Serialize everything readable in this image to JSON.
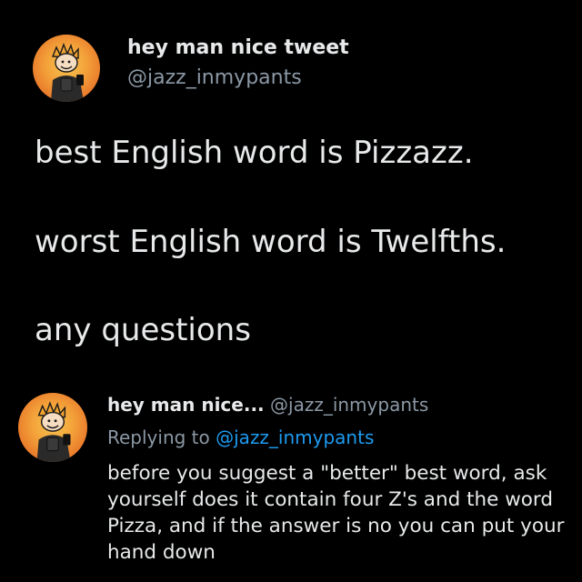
{
  "main_tweet": {
    "author_name": "hey man nice tweet",
    "author_handle": "@jazz_inmypants",
    "avatar_icon": "cartoon-boy-avatar-icon",
    "lines": [
      "best English word is Pizzazz.",
      "worst English word is Twelfths.",
      "any questions"
    ]
  },
  "reply_tweet": {
    "author_name": "hey man nice...",
    "author_handle": "@jazz_inmypants",
    "replying_to_label": "Replying to",
    "replying_to_handle": "@jazz_inmypants",
    "avatar_icon": "cartoon-boy-avatar-icon",
    "text_lines": [
      "before you suggest a \"better\" best word, ask",
      "yourself does it contain four Z's and the word",
      "Pizza, and if the answer is no you can put your",
      "hand down"
    ]
  },
  "colors": {
    "background": "#000000",
    "text": "#e7e9ea",
    "muted": "#8b98a5",
    "link": "#1d9bf0",
    "avatar_orange": "#ea7d2c"
  }
}
